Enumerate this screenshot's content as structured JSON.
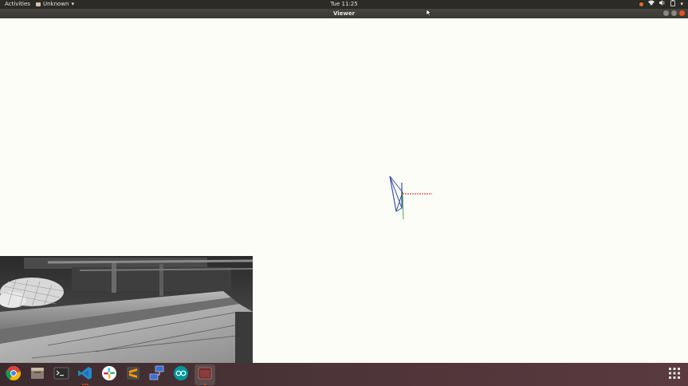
{
  "topbar": {
    "activities": "Activities",
    "app_name": "Unknown",
    "clock": "Tue 11:25"
  },
  "window": {
    "title": "Viewer"
  },
  "colors": {
    "accent": "#e95420",
    "topbar_bg": "#2b2b27",
    "viewer_bg": "#fdfdf8",
    "frustum_blue": "#3a4aa8",
    "axis_red": "#d11a1a",
    "axis_green": "#3bb13b"
  },
  "taskbar": {
    "items": [
      {
        "icon": "chrome-icon"
      },
      {
        "icon": "files-icon"
      },
      {
        "icon": "terminal-icon"
      },
      {
        "icon": "vscode-icon"
      },
      {
        "icon": "slack-icon"
      },
      {
        "icon": "sublime-text-icon"
      },
      {
        "icon": "network-manager-icon"
      },
      {
        "icon": "arduino-icon"
      },
      {
        "icon": "viewer-app-icon"
      }
    ],
    "show_apps_icon": "app-grid-icon"
  }
}
